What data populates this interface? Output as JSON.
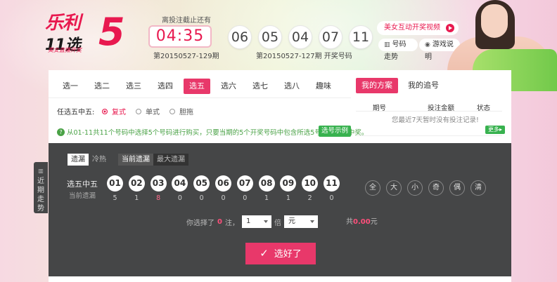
{
  "logo": {
    "top": "乐利",
    "bottom": "11选",
    "five": "5",
    "sub": "美女直播开奖"
  },
  "countdown": {
    "label": "离投注截止还有",
    "time": "04:35",
    "period": "第20150527-129期"
  },
  "last_draw": {
    "balls": [
      "06",
      "05",
      "04",
      "07",
      "11"
    ],
    "label": "第20150527-127期  开奖号码"
  },
  "links": {
    "video": "美女互动开奖视频",
    "trend": "号码走势",
    "help": "游戏说明"
  },
  "tabs": [
    "选一",
    "选二",
    "选三",
    "选四",
    "选五",
    "选六",
    "选七",
    "选八",
    "趣味"
  ],
  "active_tab": "选五",
  "plan_tabs": [
    {
      "label": "我的方案",
      "active": true
    },
    {
      "label": "我的追号",
      "active": false
    }
  ],
  "mode": {
    "label": "任选五中五:",
    "options": [
      {
        "label": "复式",
        "active": true
      },
      {
        "label": "单式",
        "active": false
      },
      {
        "label": "胆拖",
        "active": false
      }
    ]
  },
  "description": "从01-11共11个号码中选择5个号码进行购买，只要当期的5个开奖号码中包含所选5号码，即为中奖。",
  "example_button": "选号示例",
  "records": {
    "headers": [
      "期号",
      "投注金额",
      "状态"
    ],
    "empty": "您最近7天暂时没有投注记录!",
    "more": "更多▸"
  },
  "stats_tabs": [
    {
      "label": "遗漏",
      "active": true
    },
    {
      "label": "冷热",
      "active": false
    }
  ],
  "stats_tabs2": [
    {
      "label": "当前遗漏",
      "active": true
    },
    {
      "label": "最大遗漏",
      "active": false
    }
  ],
  "pick": {
    "row_label": "选五中五",
    "row_sub": "当前遗漏",
    "balls": [
      {
        "num": "01",
        "miss": "5"
      },
      {
        "num": "02",
        "miss": "1"
      },
      {
        "num": "03",
        "miss": "8",
        "hot": true
      },
      {
        "num": "04",
        "miss": "0"
      },
      {
        "num": "05",
        "miss": "0"
      },
      {
        "num": "06",
        "miss": "0"
      },
      {
        "num": "07",
        "miss": "0"
      },
      {
        "num": "08",
        "miss": "1"
      },
      {
        "num": "09",
        "miss": "1"
      },
      {
        "num": "10",
        "miss": "2"
      },
      {
        "num": "11",
        "miss": "0"
      }
    ],
    "quick": [
      "全",
      "大",
      "小",
      "奇",
      "偶",
      "清"
    ]
  },
  "selection": {
    "prefix": "你选择了",
    "count": "0",
    "suffix": "注，",
    "multiple": "1",
    "multiple_unit": "倍",
    "currency": "元",
    "total_prefix": "共",
    "total": "0.00",
    "total_unit": "元"
  },
  "confirm_label": "选好了",
  "side_trend": "近期走势"
}
